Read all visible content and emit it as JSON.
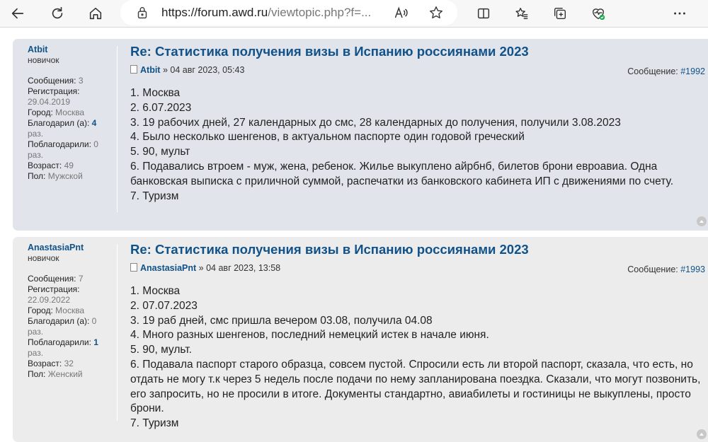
{
  "browser": {
    "url_main": "https://forum.awd.ru",
    "url_rest": "/viewtopic.php?f=...",
    "icons": [
      "back-icon",
      "refresh-icon",
      "home-icon",
      "lock-icon",
      "read-aloud-icon",
      "favorite-star-icon",
      "split-screen-icon",
      "favorites-icon",
      "collections-icon",
      "browser-essentials-icon",
      "more-icon"
    ]
  },
  "posts": [
    {
      "username": "Atbit",
      "rank": "новичок",
      "stats": {
        "messages_label": "Сообщения:",
        "messages": "3",
        "registration_label": "Регистрация:",
        "registration": "29.04.2019",
        "city_label": "Город:",
        "city": "Москва",
        "thanked_label": "Благодарил (а):",
        "thanked": "4",
        "thanked_unit": "раз.",
        "was_thanked_label": "Поблагодарили:",
        "was_thanked": "0",
        "was_thanked_unit": "раз.",
        "age_label": "Возраст:",
        "age": "49",
        "gender_label": "Пол:",
        "gender": "Мужской"
      },
      "title": "Re: Статистика получения визы в Испанию россиянами 2023",
      "author": "Atbit",
      "date": " » 04 авг 2023, 05:43",
      "msg_label": "Сообщение: ",
      "msg_num": "#1992",
      "lines": [
        "1. Москва",
        "2. 6.07.2023",
        "3. 19 рабочих дней, 27 календарных до смс, 28 календарных до получения, получили 3.08.2023",
        "4. Было несколько шенгенов, в актуальном паспорте один годовой греческий",
        "5. 90, мульт",
        "6. Подавались втроем - муж, жена, ребенок. Жилье выкуплено айрбнб, билетов брони евроавиа. Одна банковская выписка с приличной суммой, распечатки из банковского кабинета ИП с движениями по счету.",
        "7. Туризм"
      ]
    },
    {
      "username": "AnastasiaPnt",
      "rank": "новичок",
      "stats": {
        "messages_label": "Сообщения:",
        "messages": "7",
        "registration_label": "Регистрация:",
        "registration": "22.09.2022",
        "city_label": "Город:",
        "city": "Москва",
        "thanked_label": "Благодарил (а):",
        "thanked": "0",
        "thanked_unit": "раз.",
        "was_thanked_label": "Поблагодарили:",
        "was_thanked": "1",
        "was_thanked_unit": "раз.",
        "age_label": "Возраст:",
        "age": "32",
        "gender_label": "Пол:",
        "gender": "Женский"
      },
      "title": "Re: Статистика получения визы в Испанию россиянами 2023",
      "author": "AnastasiaPnt",
      "date": " » 04 авг 2023, 13:58",
      "msg_label": "Сообщение: ",
      "msg_num": "#1993",
      "lines": [
        "1. Москва",
        "2. 07.07.2023",
        "3. 19 раб дней, смс пришла вечером 03.08, получила 04.08",
        "4. Много разных шенгенов, последний немецкий истек в начале июня.",
        "5. 90, мульт.",
        "6. Подавала паспорт старого образца, совсем пустой. Спросили есть ли второй паспорт, сказала, что есть, но отдать не могу т.к через 5 недель после подачи по нему запланирована поездка. Сказали, что могут позвонить, его запросить, но не просили в итоге. Документы стандартно, авиабилеты и гостиницы не выкуплены, просто брони.",
        "7. Туризм"
      ]
    }
  ]
}
